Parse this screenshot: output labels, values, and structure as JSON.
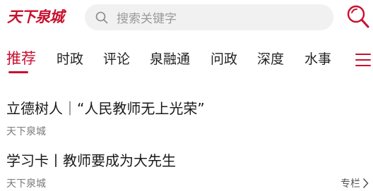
{
  "header": {
    "logo_text": "天下泉城",
    "search_placeholder": "搜索关键字"
  },
  "tabs": [
    {
      "label": "推荐",
      "active": true
    },
    {
      "label": "时政",
      "active": false
    },
    {
      "label": "评论",
      "active": false
    },
    {
      "label": "泉融通",
      "active": false
    },
    {
      "label": "问政",
      "active": false
    },
    {
      "label": "深度",
      "active": false
    },
    {
      "label": "水事",
      "active": false
    }
  ],
  "feed": [
    {
      "title": "立德树人｜“人民教师无上光荣”",
      "source": "天下泉城"
    },
    {
      "title": "学习卡丨教师要成为大先生",
      "source": "天下泉城",
      "topic": "专栏"
    }
  ],
  "colors": {
    "accent": "#c8102e",
    "search_bg": "#f1f1f1"
  },
  "icons": {
    "search": "search-icon",
    "menu": "menu-icon",
    "chevron": "chevron-right-icon"
  }
}
